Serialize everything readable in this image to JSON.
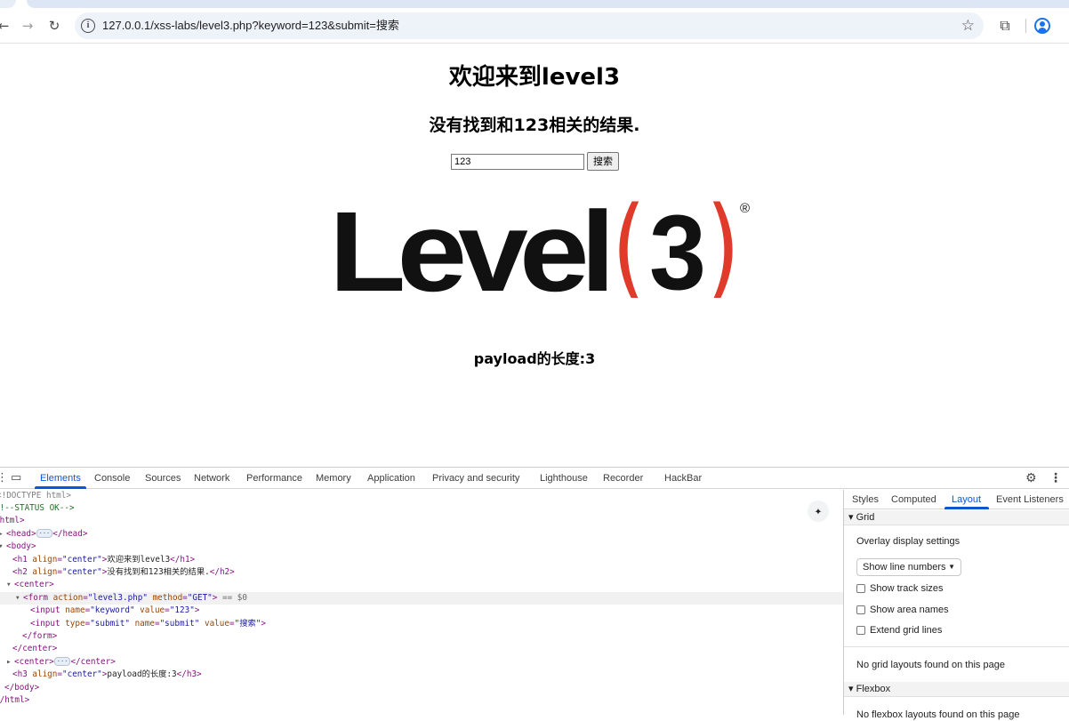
{
  "browser": {
    "url": "127.0.0.1/xss-labs/level3.php?keyword=123&submit=搜索",
    "icons": [
      "back-icon",
      "forward-icon",
      "reload-icon",
      "site-info-icon",
      "bookmark-star-icon",
      "extensions-icon",
      "profile-icon"
    ],
    "accent": "#1a73e8"
  },
  "page": {
    "h1": "欢迎来到level3",
    "h2": "没有找到和123相关的结果.",
    "keyword_value": "123",
    "submit_label": "搜索",
    "logo_text": "Level",
    "logo_digit": "3",
    "logo_paren_left": "(",
    "logo_paren_right": ")",
    "logo_reg": "®",
    "logo_paren_color": "#e03a2a",
    "h3": "payload的长度:3"
  },
  "devtools": {
    "tabs": [
      "Elements",
      "Console",
      "Sources",
      "Network",
      "Performance",
      "Memory",
      "Application",
      "Privacy and security",
      "Lighthouse",
      "Recorder",
      "HackBar"
    ],
    "active_tab": "Elements",
    "dom": {
      "doctype": "<!DOCTYPE html>",
      "comment": "<!--STATUS OK-->",
      "html_open": "<html>",
      "head": "head",
      "body": "body",
      "h1_text": "欢迎来到level3",
      "h2_text": "没有找到和123相关的结果.",
      "form_selected_marker": "== $0",
      "input_keyword_value": "123",
      "input_submit_value": "搜索",
      "h3_text": "payload的长度:3"
    },
    "side_tabs": [
      "Styles",
      "Computed",
      "Layout",
      "Event Listeners"
    ],
    "side_active_tab": "Layout",
    "layout": {
      "grid_header": "Grid",
      "overlay_label": "Overlay display settings",
      "line_numbers_option": "Show line numbers",
      "show_track_sizes": "Show track sizes",
      "show_area_names": "Show area names",
      "extend_grid_lines": "Extend grid lines",
      "no_grid": "No grid layouts found on this page",
      "flexbox_header": "Flexbox",
      "no_flexbox": "No flexbox layouts found on this page"
    }
  }
}
